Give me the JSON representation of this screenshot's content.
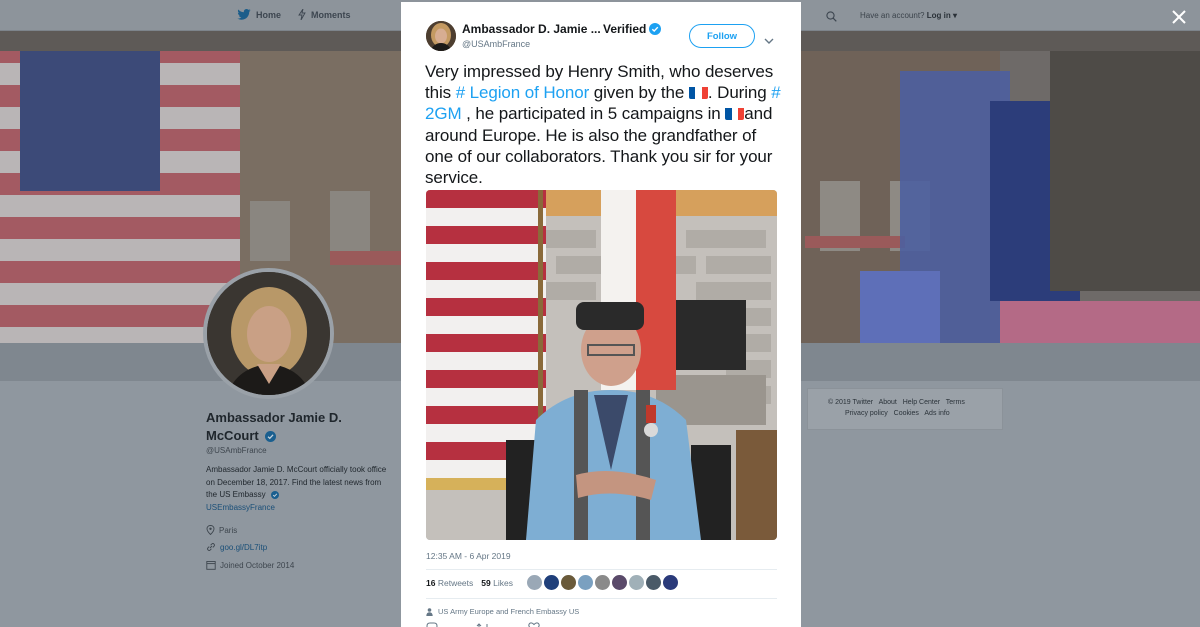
{
  "topbar": {
    "home_label": "Home",
    "moments_label": "Moments",
    "have_account": "Have an account?",
    "login_label": "Log in ▾"
  },
  "profile": {
    "name": "Ambassador Jamie D. McCourt",
    "handle": "@USAmbFrance",
    "bio": "Ambassador Jamie D. McCourt officially took office on December 18, 2017. Find the latest news from the US Embassy",
    "bio_link": "USEmbassyFrance",
    "location": "Paris",
    "website": "goo.gl/DL7itp",
    "joined": "Joined October 2014"
  },
  "footer": {
    "copyright": "© 2019 Twitter",
    "about": "About",
    "help": "Help Center",
    "terms": "Terms",
    "privacy": "Privacy policy",
    "cookies": "Cookies",
    "ads": "Ads info"
  },
  "tweet": {
    "author_name": "Ambassador D. Jamie ...",
    "verified_label": "Verified",
    "author_handle": "@USAmbFrance",
    "follow_label": "Follow",
    "text_1": "Very impressed by Henry Smith, who deserves this ",
    "hashtag_1": "# Legion of Honor",
    "text_2": " given by the ",
    "text_3": ". During ",
    "hashtag_2": "# 2GM",
    "text_4": " , he participated in 5 campaigns in ",
    "text_5": "and around Europe. He is also the grandfather of one of our collaborators. Thank you sir for your service.",
    "timestamp": "12:35 AM - 6 Apr 2019",
    "retweets_count": "16",
    "retweets_label": "Retweets",
    "likes_count": "59",
    "likes_label": "Likes",
    "tagged": "US Army Europe and French Embassy US"
  },
  "colors": {
    "twitter_blue": "#1da1f2",
    "text_primary": "#14171a",
    "text_secondary": "#657786",
    "overlay_bg": "#8f979f"
  },
  "icons": [
    "twitter-bird-icon",
    "moments-icon",
    "search-icon",
    "close-icon",
    "verified-icon",
    "chevron-down-icon",
    "location-icon",
    "link-icon",
    "calendar-icon",
    "person-tag-icon",
    "reply-icon",
    "retweet-icon",
    "like-icon"
  ]
}
